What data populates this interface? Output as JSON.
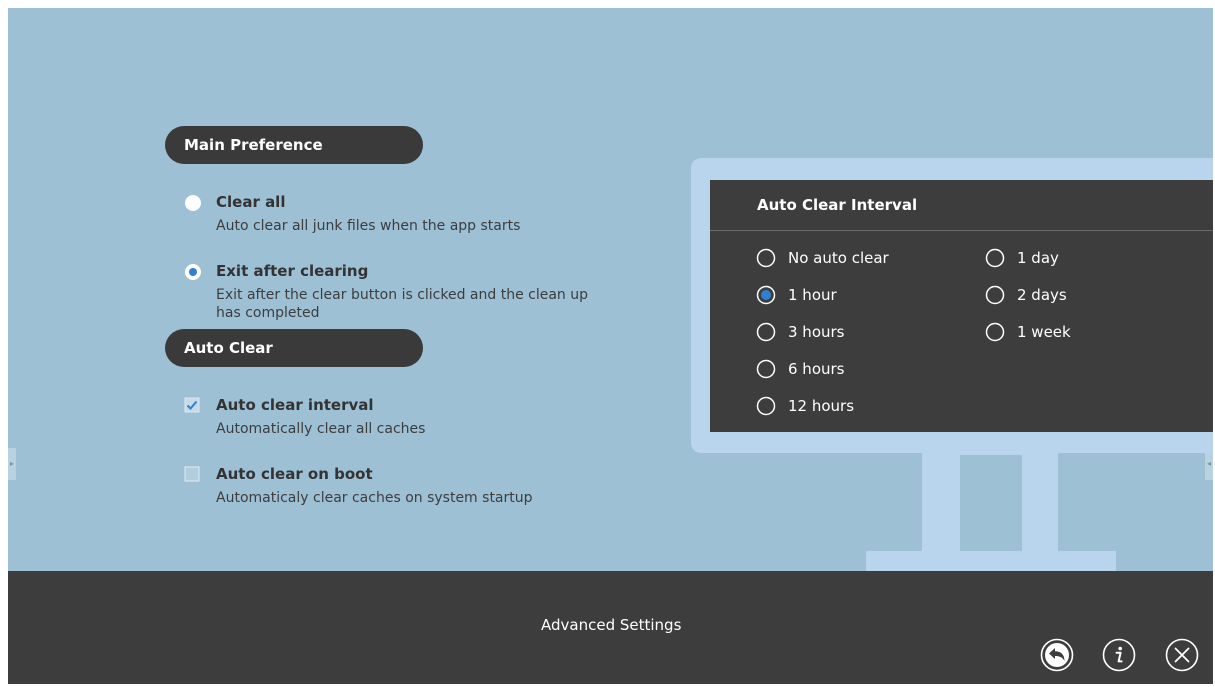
{
  "main_preference": {
    "header": "Main Preference",
    "options": [
      {
        "title": "Clear all",
        "desc": "Auto clear all junk files when the app starts",
        "selected": false
      },
      {
        "title": "Exit after clearing",
        "desc": "Exit after the clear button is clicked and the clean up has completed",
        "selected": true
      }
    ]
  },
  "auto_clear": {
    "header": "Auto Clear",
    "options": [
      {
        "title": "Auto clear interval",
        "desc": "Automatically clear all caches",
        "checked": true
      },
      {
        "title": "Auto clear on boot",
        "desc": "Automaticaly clear caches on system startup",
        "checked": false
      }
    ]
  },
  "interval_panel": {
    "title": "Auto Clear Interval",
    "options": [
      {
        "label": "No auto clear",
        "selected": false
      },
      {
        "label": "1 hour",
        "selected": true
      },
      {
        "label": "3 hours",
        "selected": false
      },
      {
        "label": "6 hours",
        "selected": false
      },
      {
        "label": "12 hours",
        "selected": false
      },
      {
        "label": "1 day",
        "selected": false
      },
      {
        "label": "2 days",
        "selected": false
      },
      {
        "label": "1 week",
        "selected": false
      }
    ]
  },
  "footer": {
    "title": "Advanced Settings",
    "buttons": [
      {
        "name": "back",
        "icon": "back-arrow-icon"
      },
      {
        "name": "info",
        "icon": "info-icon"
      },
      {
        "name": "close",
        "icon": "close-icon"
      }
    ]
  },
  "colors": {
    "background": "#9dc0d4",
    "dark": "#3d3d3d",
    "accent": "#2f7fd6",
    "monitor": "#b9d5ee"
  }
}
